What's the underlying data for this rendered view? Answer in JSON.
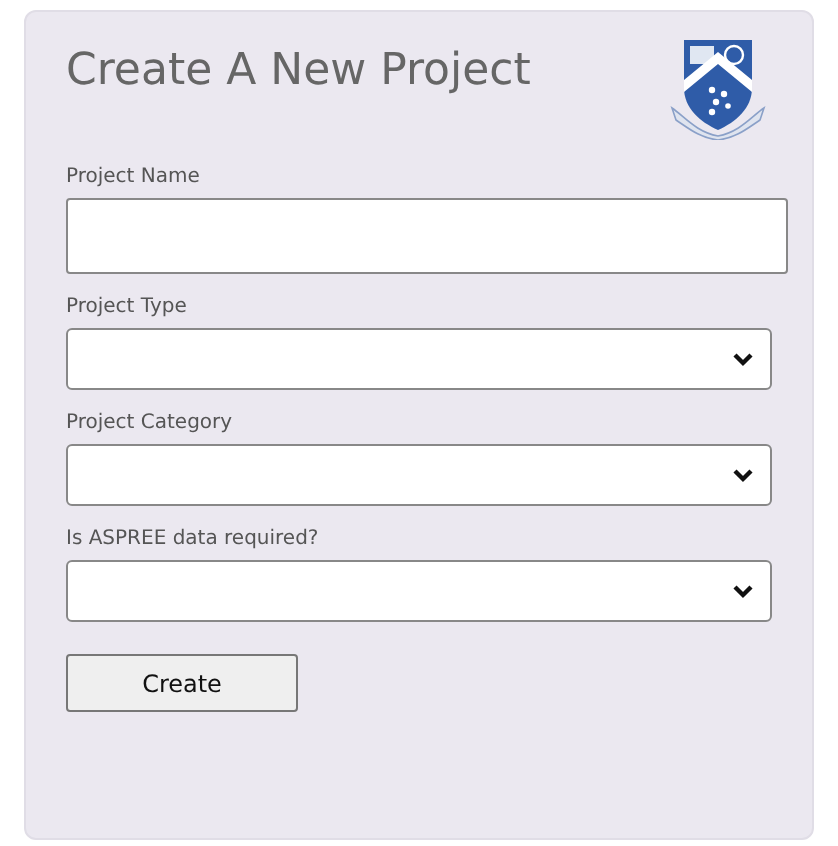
{
  "title": "Create A New Project",
  "fields": [
    {
      "label": "Project Name",
      "kind": "text"
    },
    {
      "label": "Project Type",
      "kind": "select"
    },
    {
      "label": "Project Category",
      "kind": "select"
    },
    {
      "label": "Is ASPREE data required?",
      "kind": "select"
    }
  ],
  "button": "Create"
}
